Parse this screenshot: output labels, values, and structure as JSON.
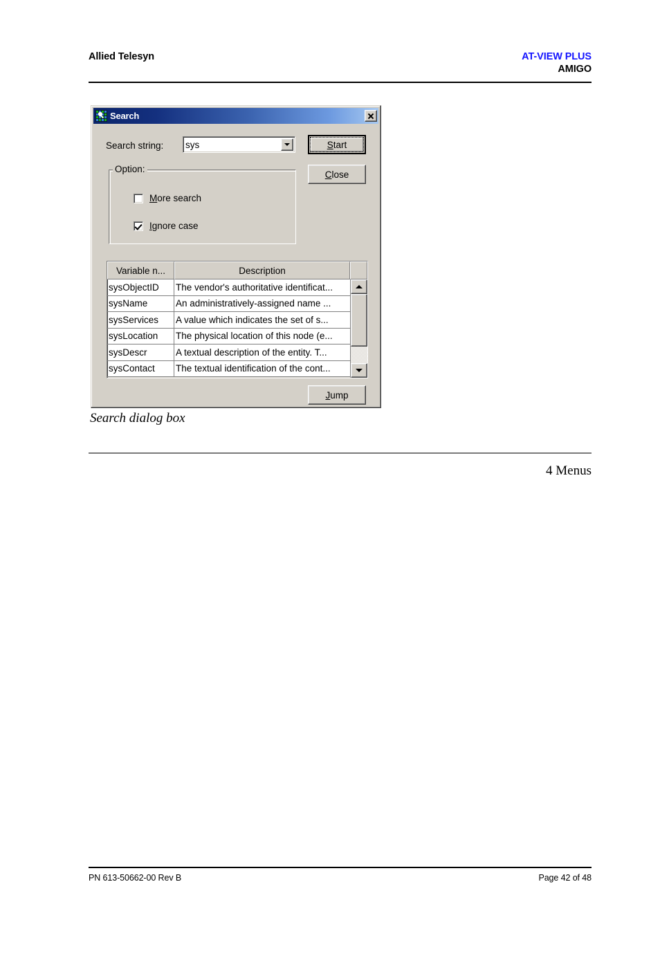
{
  "document": {
    "header": {
      "left": "Allied Telesyn",
      "right_top": "AT-VIEW PLUS",
      "right_bottom": "AMIGO",
      "accent_color": "#1414ff"
    },
    "figure_caption": "Search dialog box",
    "section_label": "4 Menus",
    "footer": {
      "left": "PN 613-50662-00 Rev B",
      "right": "Page 42 of 48"
    }
  },
  "dialog": {
    "title": "Search",
    "icon": "search-grid-icon",
    "close_icon": "close-icon",
    "search_string": {
      "label": "Search string:",
      "value": "sys",
      "dropdown_icon": "chevron-down-icon"
    },
    "buttons": {
      "start": {
        "label": "Start",
        "accelerator": "S",
        "is_default": true
      },
      "close": {
        "label": "Close",
        "accelerator": "C",
        "is_default": false
      },
      "jump": {
        "label": "Jump",
        "accelerator": "J",
        "is_default": false
      }
    },
    "option_group": {
      "legend": "Option:",
      "checkboxes": [
        {
          "label": "More search",
          "accelerator": "M",
          "checked": false
        },
        {
          "label": "Ignore case",
          "accelerator": "I",
          "checked": true
        }
      ]
    },
    "results_table": {
      "columns": [
        "Variable n...",
        "Description"
      ],
      "rows": [
        {
          "variable": "sysObjectID",
          "description": "The vendor's authoritative identificat..."
        },
        {
          "variable": "sysName",
          "description": "An administratively-assigned name ..."
        },
        {
          "variable": "sysServices",
          "description": "A value which indicates the set of s..."
        },
        {
          "variable": "sysLocation",
          "description": "The physical location of this node (e..."
        },
        {
          "variable": "sysDescr",
          "description": "A textual description of the entity.  T..."
        },
        {
          "variable": "sysContact",
          "description": "The textual identification of the cont..."
        }
      ],
      "scrollbar": {
        "up_icon": "scroll-up-arrow-icon",
        "down_icon": "scroll-down-arrow-icon"
      }
    },
    "colors": {
      "face": "#d4d0c8",
      "title_gradient_start": "#0a246a",
      "title_gradient_end": "#a6c8f0"
    }
  }
}
